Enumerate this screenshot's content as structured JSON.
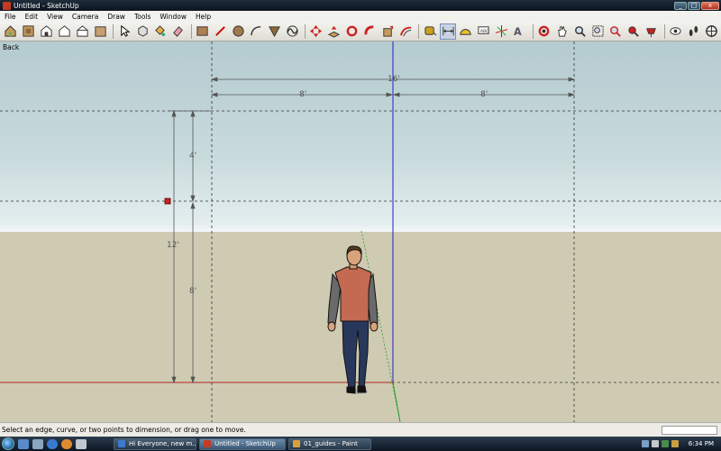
{
  "window": {
    "title": "Untitled - SketchUp",
    "minimize": "_",
    "maximize": "□",
    "close": "x"
  },
  "menu": [
    "File",
    "Edit",
    "View",
    "Camera",
    "Draw",
    "Tools",
    "Window",
    "Help"
  ],
  "toolbar": {
    "tools": [
      "iso-view-icon",
      "top-view-icon",
      "front-view-icon",
      "right-view-icon",
      "back-view-icon",
      "left-view-icon",
      "select-icon",
      "make-component-icon",
      "paint-bucket-icon",
      "eraser-icon",
      "rectangle-icon",
      "line-icon",
      "circle-icon",
      "arc-icon",
      "polygon-icon",
      "freehand-icon",
      "move-icon",
      "push-pull-icon",
      "rotate-icon",
      "follow-me-icon",
      "scale-icon",
      "offset-icon",
      "tape-measure-icon",
      "dimension-icon",
      "protractor-icon",
      "text-icon",
      "axes-icon",
      "3d-text-icon",
      "orbit-icon",
      "pan-icon",
      "zoom-icon",
      "zoom-window-icon",
      "zoom-extents-icon",
      "previous-view-icon",
      "position-camera-icon",
      "look-around-icon",
      "walk-icon",
      "section-plane-icon"
    ],
    "active_tool": "dimension-icon"
  },
  "viewport": {
    "view_name": "Back",
    "dimensions": {
      "total_width": "16'",
      "left_half": "8'",
      "right_half": "8'",
      "total_height": "12'",
      "upper": "4'",
      "lower": "8'"
    }
  },
  "status": {
    "message": "Select an edge, curve, or two points to dimension, or drag one to move."
  },
  "taskbar": {
    "tasks": [
      {
        "label": "Hi Everyone, new m...",
        "active": false
      },
      {
        "label": "Untitled - SketchUp",
        "active": true
      },
      {
        "label": "01_guides - Paint",
        "active": false
      }
    ],
    "clock": "6:34 PM"
  }
}
